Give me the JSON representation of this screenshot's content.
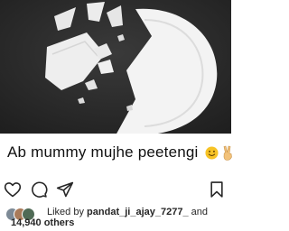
{
  "post": {
    "caption": "Ab mummy mujhe  peetengi",
    "caption_emojis": [
      "slightly-smiling-face",
      "victory-hand"
    ]
  },
  "actions": {
    "icons": [
      "heart-icon",
      "comment-icon",
      "share-icon",
      "bookmark-icon"
    ]
  },
  "likes": {
    "prefix": "Liked by",
    "user": "pandat_ji_ajay_7277_",
    "and_word": "and",
    "others": "14,940 others"
  },
  "colors": {
    "photo_background": "#2e2e2e",
    "plate": "#f4f4f4",
    "text": "#262626"
  }
}
